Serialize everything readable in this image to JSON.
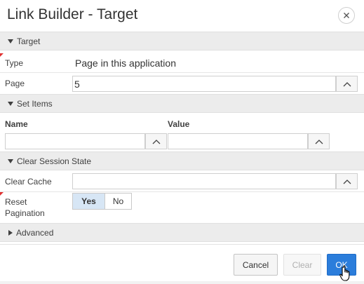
{
  "dialog": {
    "title": "Link Builder - Target"
  },
  "icons": {
    "close": "close-icon",
    "lov": "chevron-up-icon",
    "expanded": "triangle-down-icon",
    "collapsed": "triangle-right-icon",
    "cursor": "hand-pointer-cursor"
  },
  "target": {
    "section_label": "Target",
    "type_label": "Type",
    "type_value": "Page in this application",
    "page_label": "Page",
    "page_value": "5"
  },
  "set_items": {
    "section_label": "Set Items",
    "name_header": "Name",
    "value_header": "Value",
    "name_value": "",
    "value_value": ""
  },
  "clear_session_state": {
    "section_label": "Clear Session State",
    "clear_cache_label": "Clear Cache",
    "clear_cache_value": "",
    "reset_pagination_label_1": "Reset",
    "reset_pagination_label_2": "Pagination",
    "yes_label": "Yes",
    "no_label": "No",
    "selected": "Yes"
  },
  "advanced": {
    "section_label": "Advanced"
  },
  "footer": {
    "cancel_label": "Cancel",
    "clear_label": "Clear",
    "ok_label": "OK"
  },
  "colors": {
    "ok_button": "#2b7ddb",
    "selected_toggle": "#d7e6f5",
    "required": "#e03030",
    "section_bg": "#ececec"
  }
}
